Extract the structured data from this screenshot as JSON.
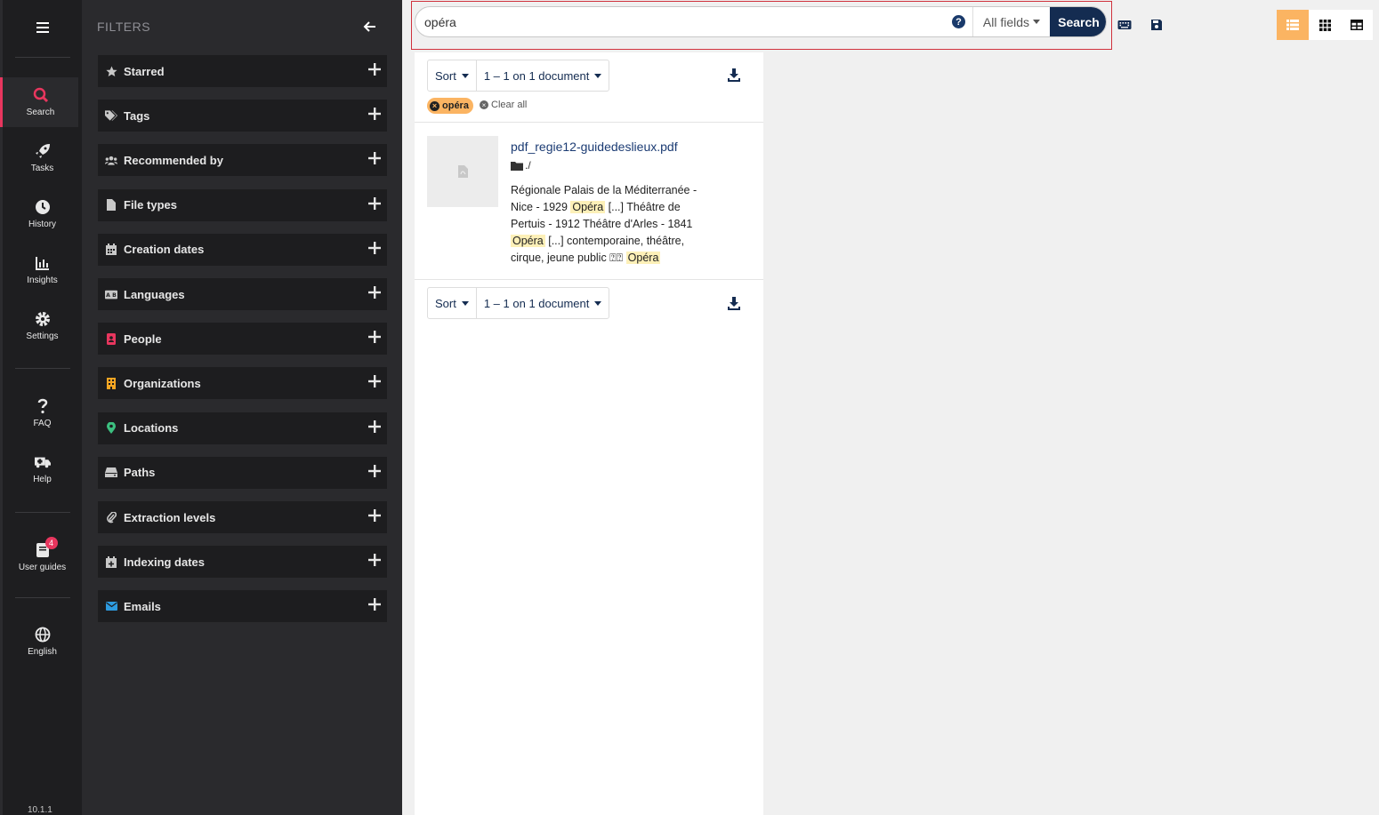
{
  "nav": {
    "items": [
      {
        "label": "Search",
        "icon": "search-icon",
        "active": true
      },
      {
        "label": "Tasks",
        "icon": "rocket-icon"
      },
      {
        "label": "History",
        "icon": "clock-icon"
      },
      {
        "label": "Insights",
        "icon": "chart-icon"
      },
      {
        "label": "Settings",
        "icon": "gear-icon"
      },
      {
        "label": "FAQ",
        "icon": "question-icon"
      },
      {
        "label": "Help",
        "icon": "ambulance-icon"
      },
      {
        "label": "User guides",
        "icon": "book-icon",
        "badge": "4"
      },
      {
        "label": "English",
        "icon": "globe-icon"
      }
    ],
    "version": "10.1.1"
  },
  "filters": {
    "title": "FILTERS",
    "items": [
      {
        "label": "Starred",
        "icon": "star-icon",
        "color": "#c8c8c8"
      },
      {
        "label": "Tags",
        "icon": "tags-icon",
        "color": "#c8c8c8"
      },
      {
        "label": "Recommended by",
        "icon": "users-icon",
        "color": "#c8c8c8"
      },
      {
        "label": "File types",
        "icon": "file-icon",
        "color": "#c8c8c8"
      },
      {
        "label": "Creation dates",
        "icon": "calendar-icon",
        "color": "#c8c8c8"
      },
      {
        "label": "Languages",
        "icon": "language-icon",
        "color": "#c8c8c8"
      },
      {
        "label": "People",
        "icon": "id-badge-icon",
        "color": "#e8365e"
      },
      {
        "label": "Organizations",
        "icon": "building-icon",
        "color": "#f5a623"
      },
      {
        "label": "Locations",
        "icon": "map-marker-icon",
        "color": "#3cc080"
      },
      {
        "label": "Paths",
        "icon": "hdd-icon",
        "color": "#c8c8c8"
      },
      {
        "label": "Extraction levels",
        "icon": "paperclip-icon",
        "color": "#c8c8c8"
      },
      {
        "label": "Indexing dates",
        "icon": "calendar-plus-icon",
        "color": "#c8c8c8"
      },
      {
        "label": "Emails",
        "icon": "envelope-icon",
        "color": "#2d9be0"
      }
    ]
  },
  "search": {
    "query": "opéra",
    "field": "All fields",
    "button": "Search",
    "help": "?"
  },
  "results": {
    "sort_label": "Sort",
    "range_label": "1 – 1 on 1 document",
    "chip": "opéra",
    "clear_all": "Clear all",
    "doc": {
      "title": "pdf_regie12-guidedeslieux.pdf",
      "path": "./",
      "snippet": [
        {
          "t": "Régionale Palais de la Méditerranée - Nice - 1929 "
        },
        {
          "t": "Opéra",
          "hl": true
        },
        {
          "t": " [...] Théâtre de Pertuis - 1912 Théâtre d'Arles - 1841 "
        },
        {
          "t": "Opéra",
          "hl": true
        },
        {
          "t": " [...] contemporaine, théâtre, cirque, jeune public ⍰⍰ "
        },
        {
          "t": "Opéra",
          "hl": true
        }
      ]
    }
  },
  "colors": {
    "accent": "#e8365e",
    "primary": "#142c51",
    "highlight": "#fbb462"
  }
}
